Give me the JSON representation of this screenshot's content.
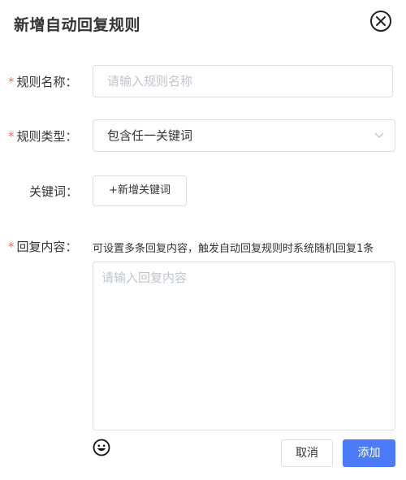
{
  "dialog": {
    "title": "新增自动回复规则"
  },
  "form": {
    "name": {
      "required_mark": "*",
      "label": "规则名称：",
      "placeholder": "请输入规则名称",
      "value": ""
    },
    "type": {
      "required_mark": "*",
      "label": "规则类型：",
      "value": "包含任一关键词"
    },
    "keywords": {
      "label": "关键词：",
      "add_button": "+新增关键词"
    },
    "reply": {
      "required_mark": "*",
      "label": "回复内容：",
      "hint": "可设置多条回复内容，触发自动回复规则时系统随机回复1条",
      "placeholder": "请输入回复内容"
    }
  },
  "footer": {
    "cancel_label": "取消",
    "confirm_label": "添加"
  },
  "icons": {
    "close": "close-circle-icon",
    "select_arrow": "chevron-down-icon",
    "emoji": "emoji-icon"
  },
  "colors": {
    "primary": "#4b7bf5",
    "required": "#f56c6c",
    "placeholder": "#c0c4cc",
    "border": "#dcdfe6"
  }
}
